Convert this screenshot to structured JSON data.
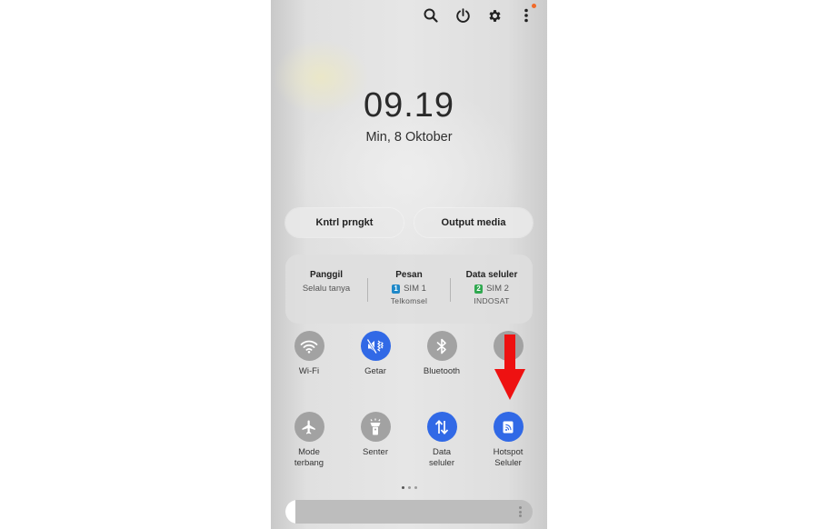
{
  "status": {
    "notification_dot_color": "#f06a2a"
  },
  "topbar": {
    "icons": [
      "search-icon",
      "power-icon",
      "gear-icon",
      "more-vert-icon"
    ]
  },
  "clock": {
    "time": "09.19",
    "date": "Min, 8 Oktober"
  },
  "pills": {
    "device_control": "Kntrl prngkt",
    "media_output": "Output media"
  },
  "sim": {
    "calls": {
      "title": "Panggil",
      "value": "Selalu tanya"
    },
    "messages": {
      "title": "Pesan",
      "badge": "1",
      "value": "SIM 1",
      "carrier": "Telkomsel",
      "badge_color": "#1e88c8"
    },
    "data": {
      "title": "Data seluler",
      "badge": "2",
      "value": "SIM 2",
      "carrier": "INDOSAT",
      "badge_color": "#2fa84f"
    }
  },
  "tiles": {
    "wifi": {
      "label": "Wi-Fi",
      "state": "off",
      "icon": "wifi-icon"
    },
    "vibrate": {
      "label": "Getar",
      "state": "on",
      "icon": "vibrate-icon"
    },
    "bluetooth": {
      "label": "Bluetooth",
      "state": "off",
      "icon": "bluetooth-icon"
    },
    "fourth": {
      "label": "",
      "state": "off",
      "icon": "unknown-icon"
    },
    "airplane": {
      "label_line1": "Mode",
      "label_line2": "terbang",
      "state": "off",
      "icon": "airplane-icon"
    },
    "flashlight": {
      "label": "Senter",
      "state": "off",
      "icon": "flashlight-icon"
    },
    "mobile_data": {
      "label_line1": "Data",
      "label_line2": "seluler",
      "state": "on",
      "icon": "data-transfer-icon"
    },
    "hotspot": {
      "label_line1": "Hotspot",
      "label_line2": "Seluler",
      "state": "on",
      "icon": "hotspot-icon"
    }
  },
  "pager": {
    "pages": 3,
    "current": 1
  },
  "brightness": {
    "level": 0.04
  },
  "annotation": {
    "arrow_color": "#ee1111",
    "icon": "red-down-arrow"
  }
}
